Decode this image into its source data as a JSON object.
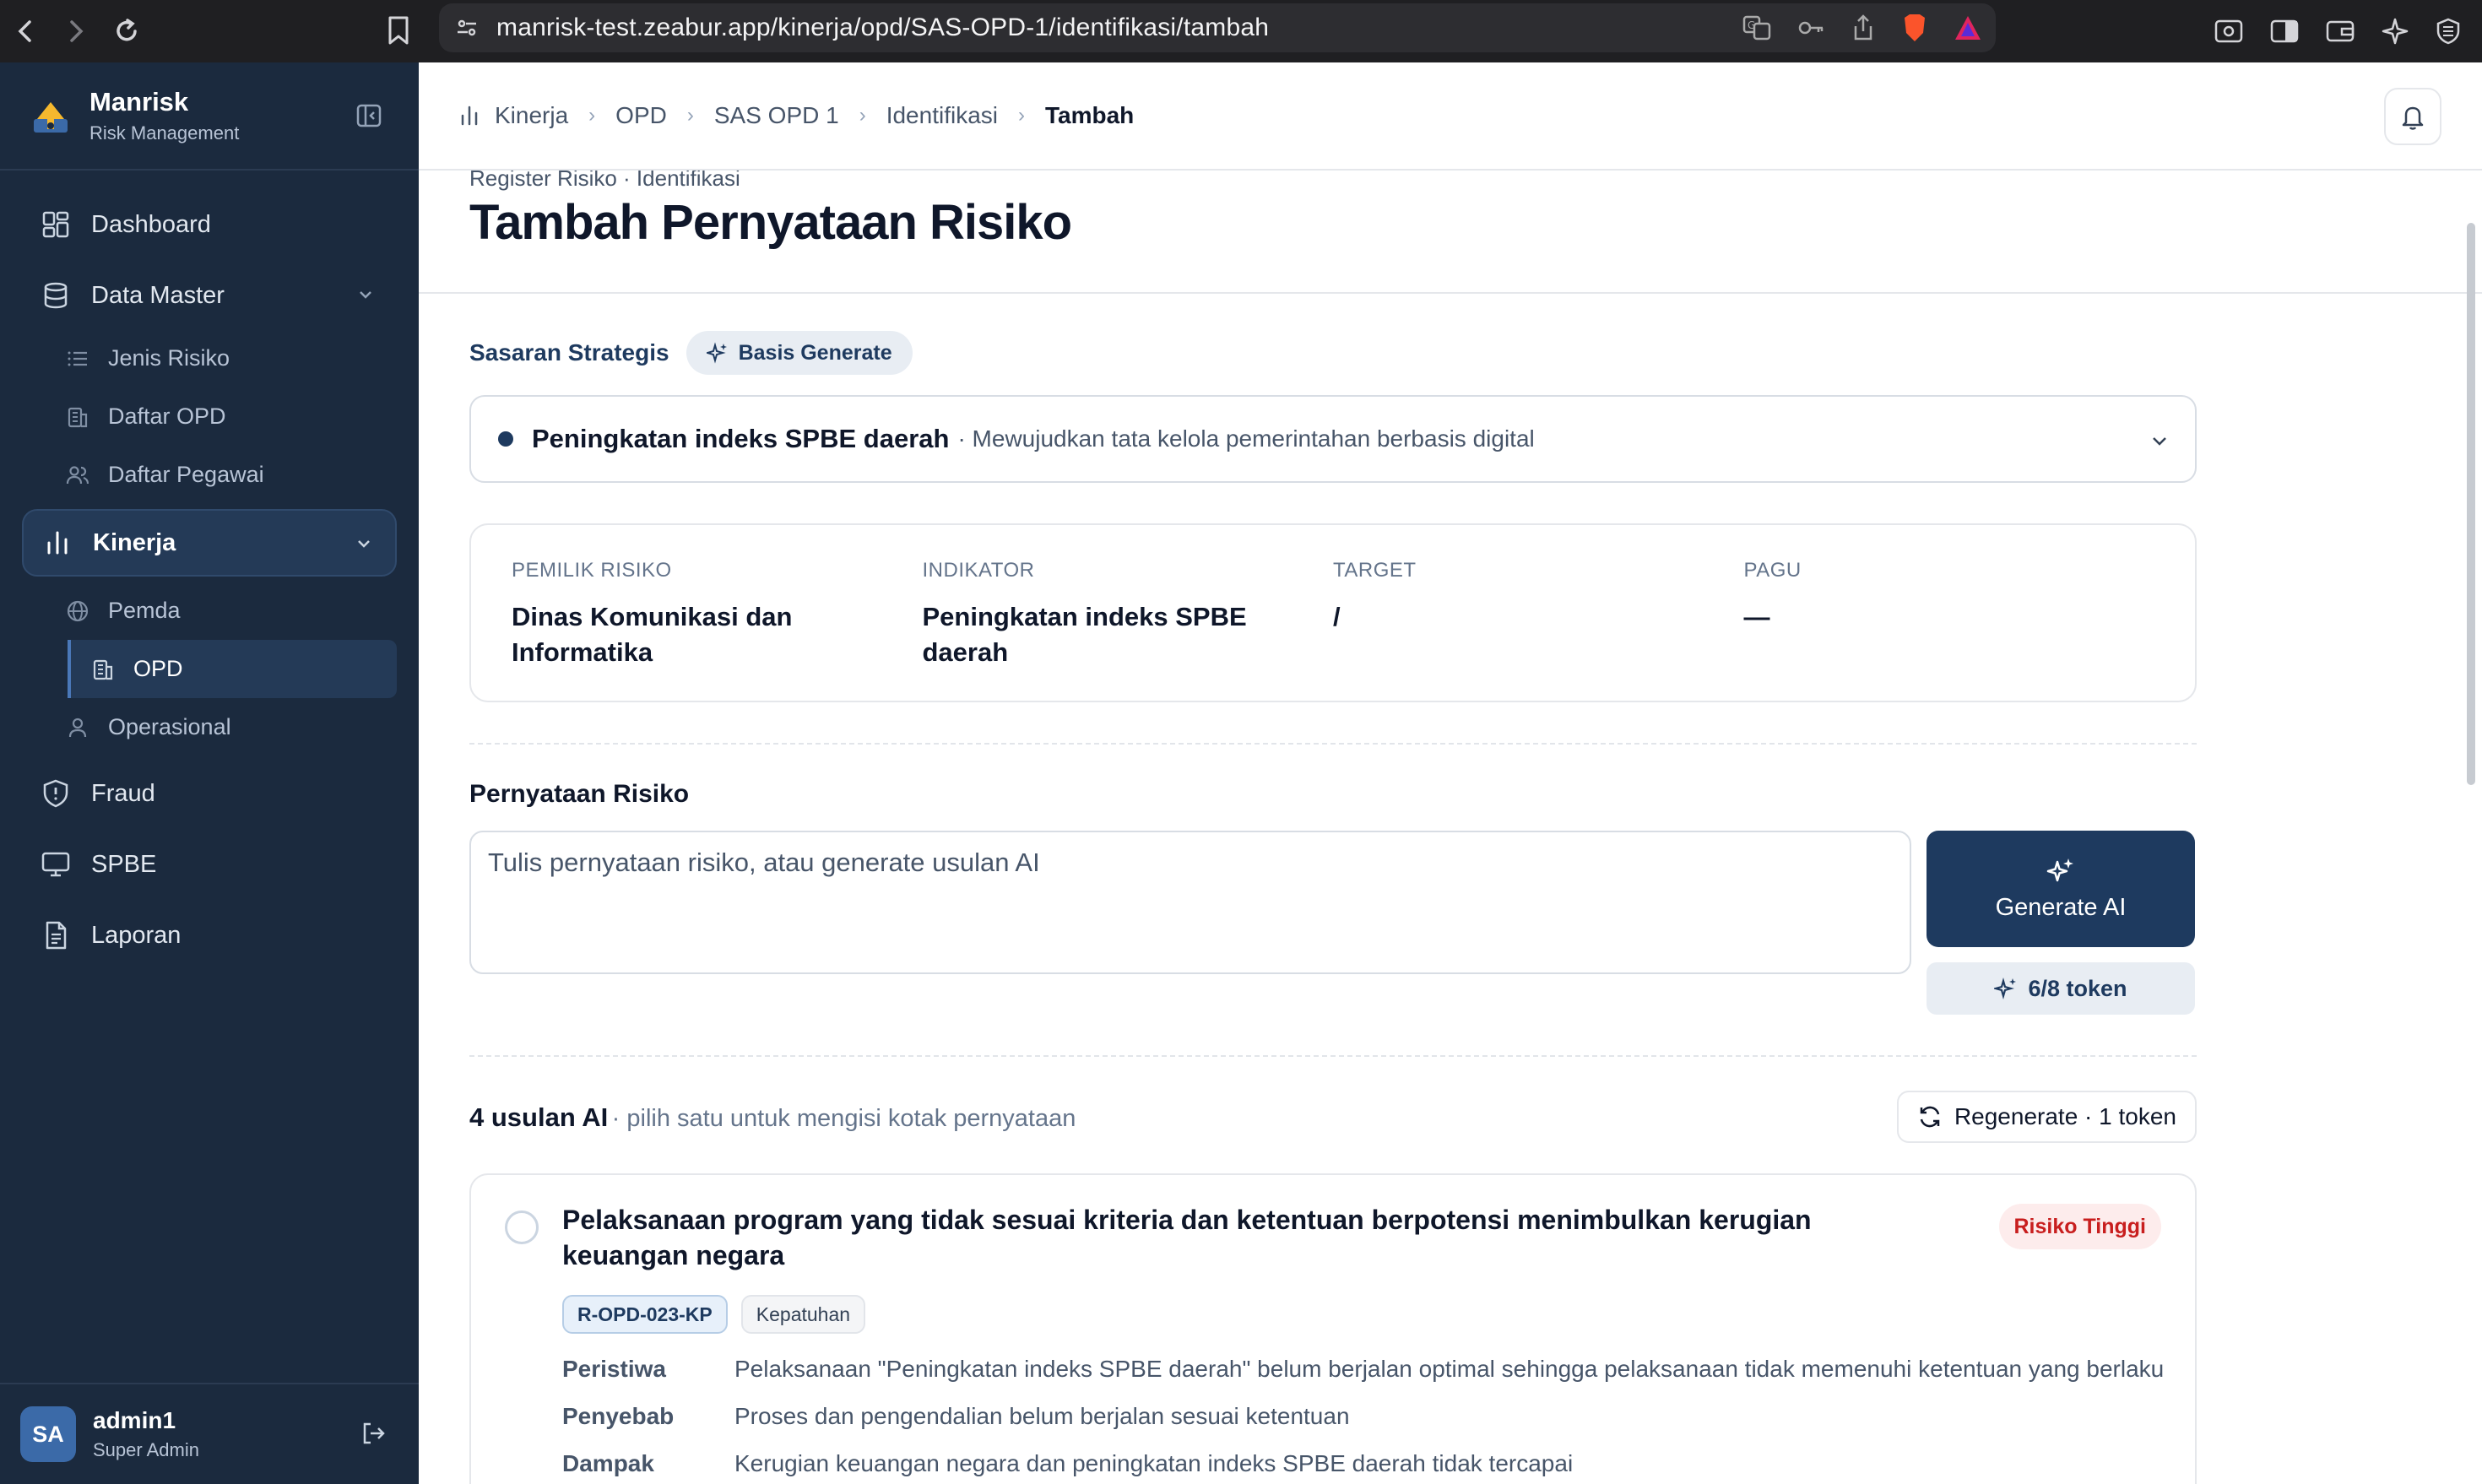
{
  "browser": {
    "url": "manrisk-test.zeabur.app/kinerja/opd/SAS-OPD-1/identifikasi/tambah"
  },
  "brand": {
    "name": "Manrisk",
    "subtitle": "Risk Management"
  },
  "sidebar": {
    "dashboard": "Dashboard",
    "data_master": "Data Master",
    "jenis_risiko": "Jenis Risiko",
    "daftar_opd": "Daftar OPD",
    "daftar_pegawai": "Daftar Pegawai",
    "kinerja": "Kinerja",
    "pemda": "Pemda",
    "opd": "OPD",
    "operasional": "Operasional",
    "fraud": "Fraud",
    "spbe": "SPBE",
    "laporan": "Laporan"
  },
  "user": {
    "initials": "SA",
    "name": "admin1",
    "role": "Super Admin"
  },
  "breadcrumb": [
    "Kinerja",
    "OPD",
    "SAS OPD 1",
    "Identifikasi",
    "Tambah"
  ],
  "page": {
    "eyebrow": "Register Risiko · Identifikasi",
    "title": "Tambah Pernyataan Risiko"
  },
  "sasaran": {
    "label": "Sasaran Strategis",
    "pill": "Basis Generate",
    "selected_main": "Peningkatan indeks SPBE daerah",
    "selected_sub": "· Mewujudkan tata kelola pemerintahan berbasis digital"
  },
  "info": [
    {
      "label": "PEMILIK RISIKO",
      "value": "Dinas Komunikasi dan Informatika"
    },
    {
      "label": "INDIKATOR",
      "value": "Peningkatan indeks SPBE daerah"
    },
    {
      "label": "TARGET",
      "value": "/"
    },
    {
      "label": "PAGU",
      "value": "—"
    }
  ],
  "pernyataan": {
    "label": "Pernyataan Risiko",
    "placeholder": "Tulis pernyataan risiko, atau generate usulan AI",
    "generate_label": "Generate AI",
    "token_label": "6/8 token"
  },
  "usulan": {
    "count_label": "4 usulan AI",
    "hint": "· pilih satu untuk mengisi kotak pernyataan",
    "regenerate_label": "Regenerate · 1 token"
  },
  "suggestion": {
    "title": "Pelaksanaan program yang tidak sesuai kriteria dan ketentuan berpotensi menimbulkan kerugian keuangan negara",
    "risk_level": "Risiko Tinggi",
    "code": "R-OPD-023-KP",
    "category": "Kepatuhan",
    "peristiwa_label": "Peristiwa",
    "peristiwa": "Pelaksanaan \"Peningkatan indeks SPBE daerah\" belum berjalan optimal sehingga pelaksanaan tidak memenuhi ketentuan yang berlaku",
    "penyebab_label": "Penyebab",
    "penyebab": "Proses dan pengendalian belum berjalan sesuai ketentuan",
    "dampak_label": "Dampak",
    "dampak": "Kerugian keuangan negara dan peningkatan indeks SPBE daerah tidak tercapai"
  },
  "colors": {
    "sidebar_bg": "#1b2a3e",
    "primary": "#1e3a5f",
    "danger": "#c81e1e"
  }
}
